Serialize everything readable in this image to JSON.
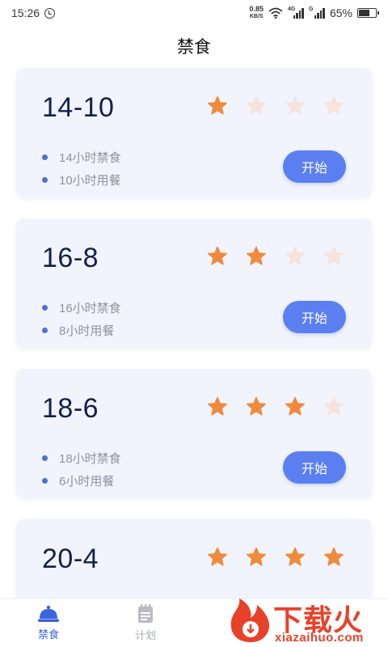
{
  "status_bar": {
    "time": "15:26",
    "net_speed": "0.85",
    "net_unit": "KB/S",
    "signal_tag_1": "4G",
    "signal_tag_2": "G",
    "battery": "65%"
  },
  "header": {
    "title": "禁食"
  },
  "plans": [
    {
      "name": "14-10",
      "stars_filled": 1,
      "stars_total": 4,
      "fasting": "14小时禁食",
      "eating": "10小时用餐",
      "button": "开始"
    },
    {
      "name": "16-8",
      "stars_filled": 2,
      "stars_total": 4,
      "fasting": "16小时禁食",
      "eating": "8小时用餐",
      "button": "开始"
    },
    {
      "name": "18-6",
      "stars_filled": 3,
      "stars_total": 4,
      "fasting": "18小时禁食",
      "eating": "6小时用餐",
      "button": "开始"
    },
    {
      "name": "20-4",
      "stars_filled": 4,
      "stars_total": 4,
      "fasting": "",
      "eating": "",
      "button": ""
    }
  ],
  "bottom_nav": {
    "items": [
      {
        "label": "禁食",
        "icon": "fasting-dome-icon",
        "active": true
      },
      {
        "label": "计划",
        "icon": "plan-notepad-icon",
        "active": false
      }
    ]
  },
  "watermark": {
    "title": "下载火",
    "url": "xiazaihuo.com"
  },
  "colors": {
    "accent": "#5b7ff0",
    "star_on": "#f08a3c",
    "star_off": "#f5e3dc",
    "card_bg": "#f1f4fd",
    "title_text": "#13204a"
  }
}
